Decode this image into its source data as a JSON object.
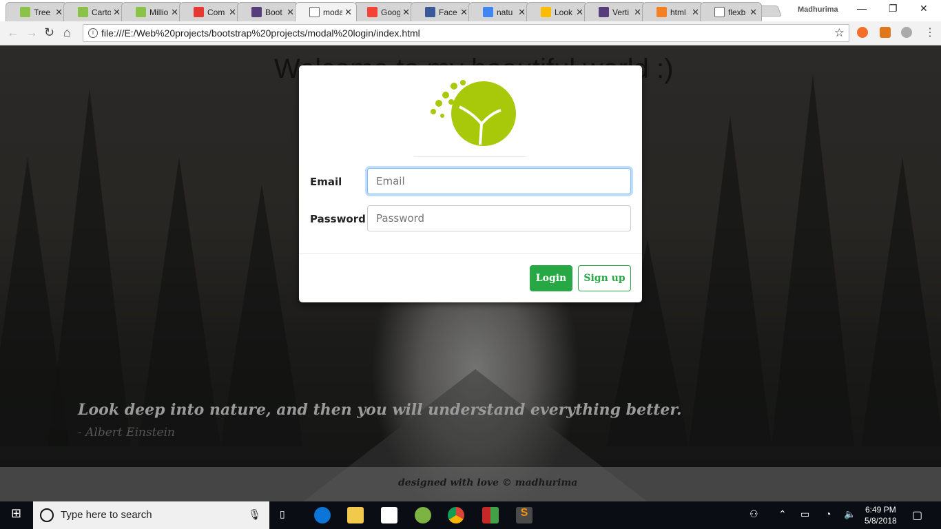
{
  "browser": {
    "tabs": [
      {
        "title": "Tree",
        "icon": "p-icon",
        "color": "#8bc34a"
      },
      {
        "title": "Carto",
        "icon": "p-icon",
        "color": "#8bc34a"
      },
      {
        "title": "Millio",
        "icon": "p-icon",
        "color": "#8bc34a"
      },
      {
        "title": "Com",
        "icon": "u-icon",
        "color": "#e53935"
      },
      {
        "title": "Boot",
        "icon": "bootstrap-icon",
        "color": "#563d7c"
      },
      {
        "title": "moda",
        "icon": "file-icon",
        "color": "#ffffff",
        "active": true
      },
      {
        "title": "Goog",
        "icon": "f-icon",
        "color": "#f44336"
      },
      {
        "title": "Face",
        "icon": "facebook-icon",
        "color": "#3b5998"
      },
      {
        "title": "natu",
        "icon": "google-icon",
        "color": "#4285f4"
      },
      {
        "title": "Look",
        "icon": "pinwheel-icon",
        "color": "#fbbc05"
      },
      {
        "title": "Verti",
        "icon": "bootstrap-icon",
        "color": "#563d7c"
      },
      {
        "title": "html",
        "icon": "stackoverflow-icon",
        "color": "#f48024"
      },
      {
        "title": "flexb",
        "icon": "file-icon",
        "color": "#ffffff"
      }
    ],
    "user": "Madhurima",
    "url": "file:///E:/Web%20projects/bootstrap%20projects/modal%20login/index.html"
  },
  "page": {
    "welcome": "Welcome to my beautiful world :)",
    "quote": "Look deep into nature, and then you will understand everything better.",
    "author": "- Albert Einstein",
    "footer": "designed with love © madhurima"
  },
  "modal": {
    "email_label": "Email",
    "email_placeholder": "Email",
    "password_label": "Password",
    "password_placeholder": "Password",
    "login": "Login",
    "signup": "Sign up",
    "accent": "#28a745",
    "logo_color": "#a8c90a"
  },
  "taskbar": {
    "search_placeholder": "Type here to search",
    "time": "6:49 PM",
    "date": "5/8/2018"
  }
}
